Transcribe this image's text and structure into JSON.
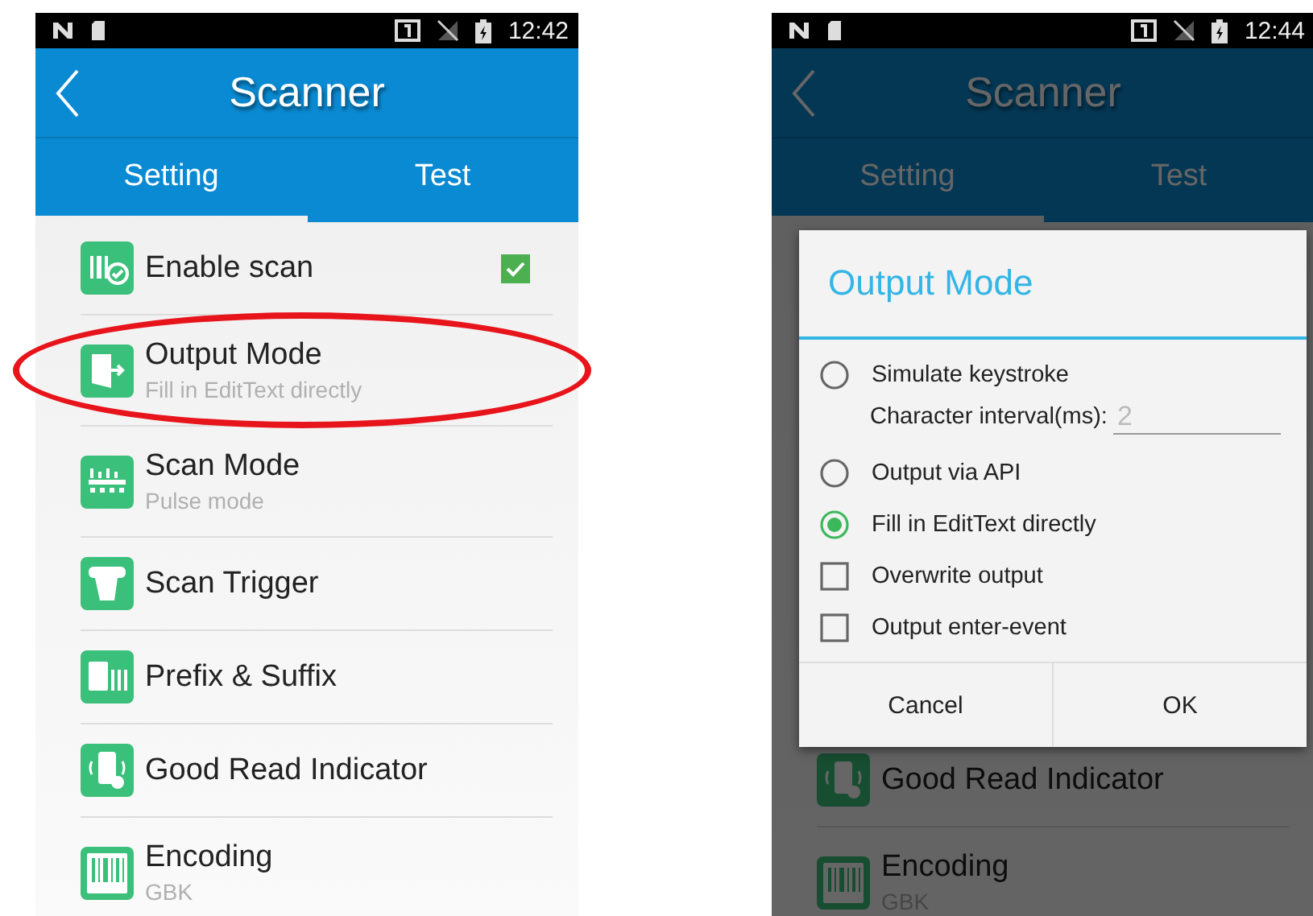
{
  "screens": [
    {
      "status_bar": {
        "time": "12:42"
      },
      "title": "Scanner",
      "dimmed": false,
      "tabs": [
        {
          "label": "Setting",
          "selected": true
        },
        {
          "label": "Test",
          "selected": false
        }
      ],
      "items": [
        {
          "kind": "barcodecheck",
          "title": "Enable scan",
          "checked": true,
          "highlighted": false
        },
        {
          "kind": "exit",
          "title": "Output Mode",
          "subtitle": "Fill in EditText directly",
          "highlighted": true
        },
        {
          "kind": "scanlines",
          "title": "Scan Mode",
          "subtitle": "Pulse mode",
          "highlighted": false
        },
        {
          "kind": "hand",
          "title": "Scan Trigger",
          "highlighted": false
        },
        {
          "kind": "letterbars",
          "title": "Prefix & Suffix",
          "highlighted": false
        },
        {
          "kind": "phone",
          "title": "Good Read Indicator",
          "highlighted": false
        },
        {
          "kind": "barcode",
          "title": "Encoding",
          "subtitle": "GBK",
          "highlighted": false
        }
      ]
    },
    {
      "status_bar": {
        "time": "12:44"
      },
      "title": "Scanner",
      "dimmed": true,
      "tabs": [
        {
          "label": "Setting",
          "selected": true
        },
        {
          "label": "Test",
          "selected": false
        }
      ],
      "items": [
        {
          "kind": "phone",
          "title": "Good Read Indicator",
          "highlighted": false
        },
        {
          "kind": "barcode",
          "title": "Encoding",
          "subtitle": "GBK",
          "highlighted": false
        }
      ],
      "dialog": {
        "title": "Output Mode",
        "options": [
          {
            "kind": "radio",
            "label": "Simulate keystroke",
            "selected": false,
            "field_label": "Character interval(ms):",
            "field_placeholder": "2"
          },
          {
            "kind": "radio",
            "label": "Output via API",
            "selected": false
          },
          {
            "kind": "radio",
            "label": "Fill in EditText directly",
            "selected": true
          },
          {
            "kind": "checkbox",
            "label": "Overwrite output",
            "checked": false
          },
          {
            "kind": "checkbox",
            "label": "Output enter-event",
            "checked": false
          }
        ],
        "buttons": [
          "Cancel",
          "OK"
        ]
      }
    }
  ]
}
